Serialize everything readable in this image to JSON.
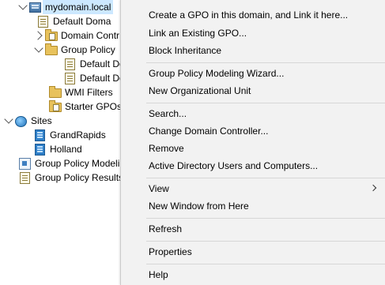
{
  "tree": {
    "domain": "mydomain.local",
    "default_domain_policy": "Default Doma",
    "domain_controllers": "Domain Contr",
    "group_policy_objects": "Group Policy",
    "gpo_child_1": "Default Do",
    "gpo_child_2": "Default Do",
    "wmi_filters": "WMI Filters",
    "starter_gpos": "Starter GPOs",
    "sites": "Sites",
    "site_1": "GrandRapids",
    "site_2": "Holland",
    "group_policy_modeling": "Group Policy Modeli",
    "group_policy_results": "Group Policy Results"
  },
  "menu": {
    "items": [
      "Create a GPO in this domain, and Link it here...",
      "Link an Existing GPO...",
      "Block Inheritance",
      "Group Policy Modeling Wizard...",
      "New Organizational Unit",
      "Search...",
      "Change Domain Controller...",
      "Remove",
      "Active Directory Users and Computers...",
      "View",
      "New Window from Here",
      "Refresh",
      "Properties",
      "Help"
    ]
  },
  "colors": {
    "menu_background": "#f2f2f2",
    "selection": "#cce8ff"
  }
}
